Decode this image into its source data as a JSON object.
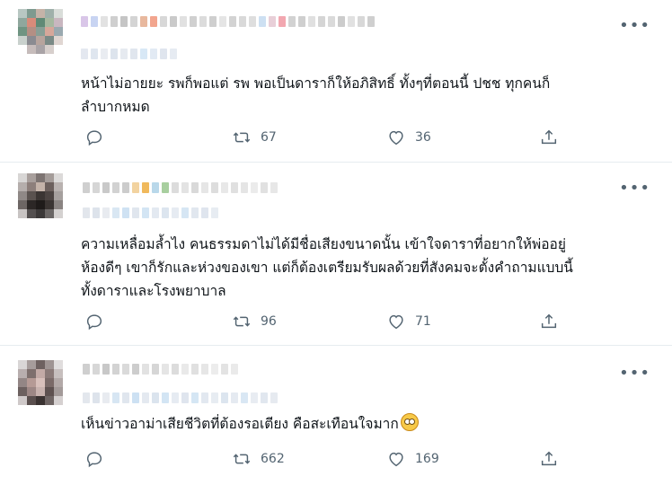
{
  "tweets": [
    {
      "text_line1": "หน้าไม่อายยะ รพก็พอแต่ รพ พอเป็นดาราก็ให้อภิสิทธิ์ ทั้งๆที่ตอนนี้ ปชช ทุกคนก็",
      "text_line2": "ลำบากหมด",
      "retweets": "67",
      "likes": "36"
    },
    {
      "text_line1": "ความเหลื่อมล้ำไง คนธรรมดาไม่ได้มีชื่อเสียงขนาดนั้น เข้าใจดาราที่อยากให้พ่ออยู่",
      "text_line2": "ห้องดีๆ เขาก็รักและห่วงของเขา แต่ก็ต้องเตรียมรับผลด้วยที่สังคมจะตั้งคำถามแบบนี้",
      "text_line3": "ทั้งดาราและโรงพยาบาล",
      "retweets": "96",
      "likes": "71"
    },
    {
      "text_line1": "เห็นข่าวอาม่าเสียชีวิตที่ต้องรอเตียง คือสะเทือนใจมาก",
      "emoji": "face-with-rolling-eyes-emoji",
      "retweets": "662",
      "likes": "169"
    }
  ],
  "more_label": "•••",
  "icons": [
    "reply-icon",
    "retweet-icon",
    "like-icon",
    "share-icon",
    "more-icon"
  ],
  "colors": {
    "text": "#0f1419",
    "secondary": "#536471",
    "divider": "#e6ecf0"
  }
}
